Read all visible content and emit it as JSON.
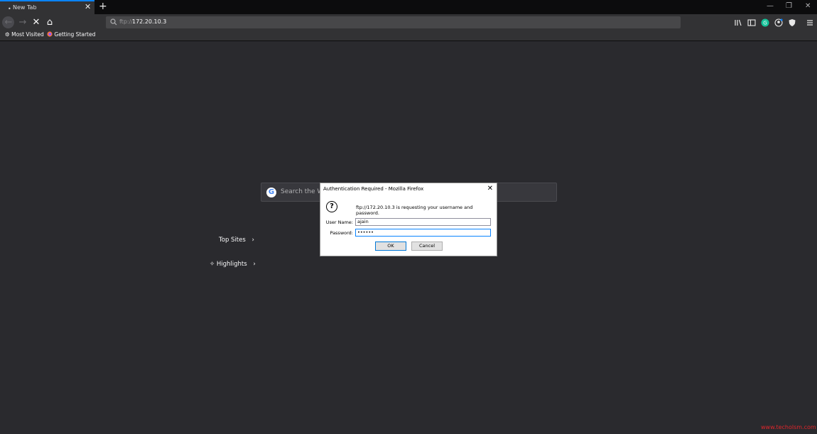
{
  "tab": {
    "title": "New Tab",
    "dot": "•",
    "close": "✕"
  },
  "newtab_label": "+",
  "window_controls": {
    "minimize": "—",
    "restore": "❐",
    "close": "✕"
  },
  "nav": {
    "back": "←",
    "forward": "→",
    "stop": "✕",
    "home": "⌂"
  },
  "url": {
    "protocol": "ftp://",
    "host": "172.20.10.3"
  },
  "toolbar_icons": [
    "library-icon",
    "sidebar-icon",
    "grammarly-icon",
    "account-icon",
    "shield-icon",
    "menu-icon"
  ],
  "bookmarks": [
    {
      "label": "Most Visited",
      "icon": "gear-icon"
    },
    {
      "label": "Getting Started",
      "icon": "firefox-icon"
    }
  ],
  "search": {
    "placeholder": "Search the We"
  },
  "sections": {
    "top_sites": "Top Sites",
    "highlights": "Highlights",
    "chevron": "›"
  },
  "dialog": {
    "title": "Authentication Required - Mozilla Firefox",
    "message": "ftp://172.20.10.3 is requesting your username and password.",
    "username_label": "User Name:",
    "username_value": "ajain",
    "password_label": "Password:",
    "password_value": "••••••",
    "ok_label": "OK",
    "cancel_label": "Cancel"
  },
  "watermark": "www.techolsm.com",
  "colors": {
    "accent": "#0a84ff",
    "background": "#2a2a2e",
    "watermark": "#e0262b"
  }
}
